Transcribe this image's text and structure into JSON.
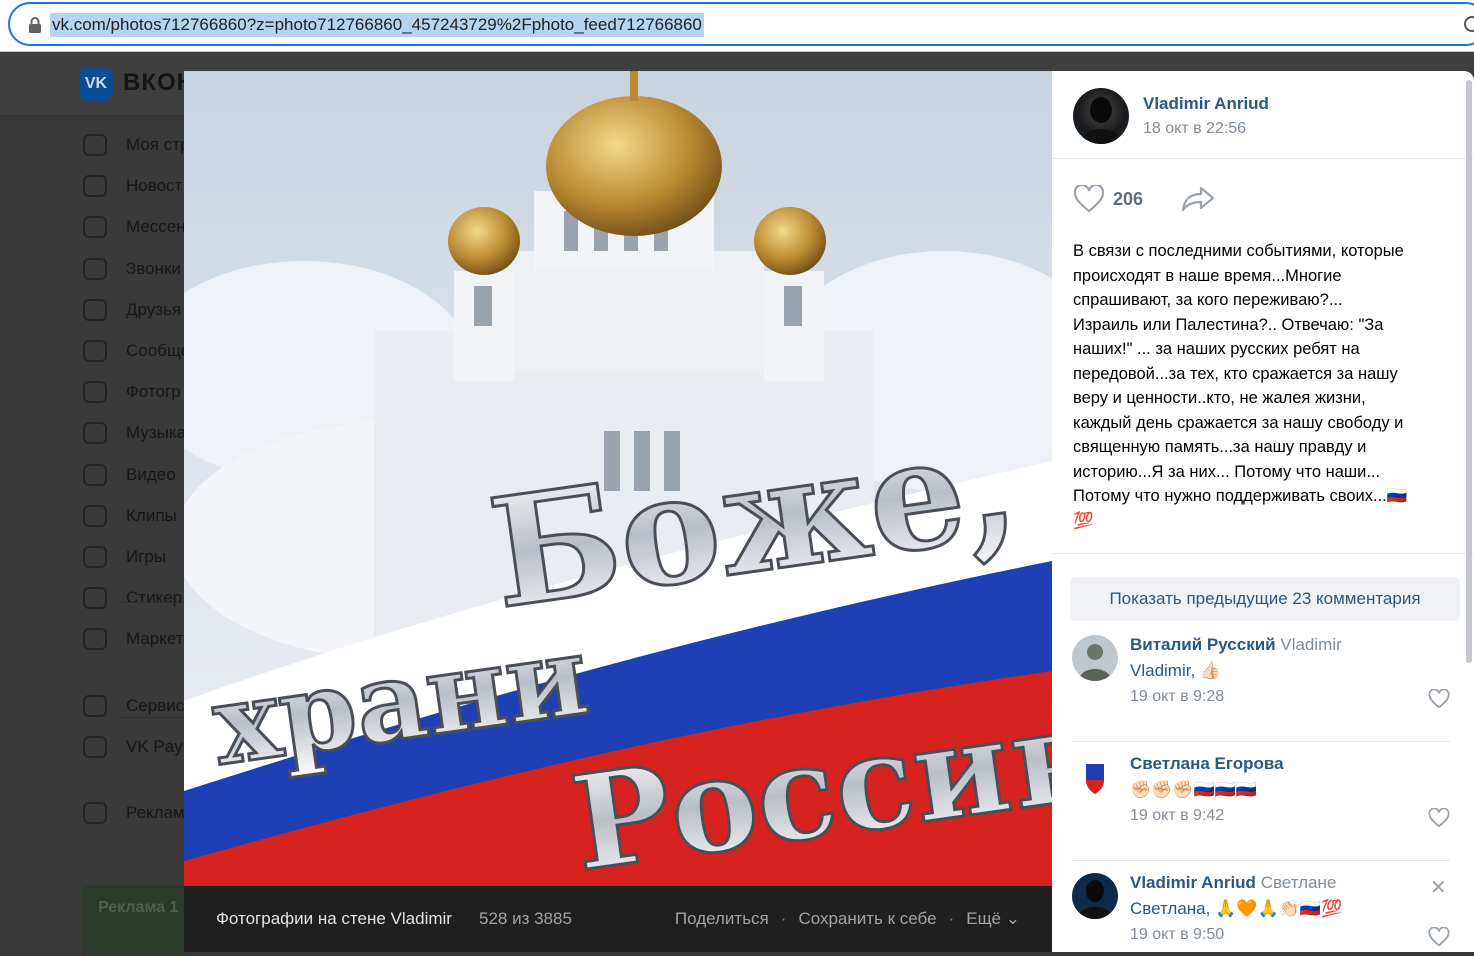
{
  "browser": {
    "url": "vk.com/photos712766860?z=photo712766860_457243729%2Fphoto_feed712766860"
  },
  "vk": {
    "brand": "ВКОН",
    "logo": "VK",
    "menu": [
      {
        "label": "Моя стр",
        "icon": "user-circle-icon"
      },
      {
        "label": "Новост",
        "icon": "news-icon"
      },
      {
        "label": "Мессен",
        "icon": "message-icon"
      },
      {
        "label": "Звонки",
        "icon": "phone-icon"
      },
      {
        "label": "Друзья",
        "icon": "friends-icon"
      },
      {
        "label": "Сообще",
        "icon": "communities-icon"
      },
      {
        "label": "Фотогр",
        "icon": "photo-icon"
      },
      {
        "label": "Музыка",
        "icon": "music-icon"
      },
      {
        "label": "Видео",
        "icon": "video-icon"
      },
      {
        "label": "Клипы",
        "icon": "clips-icon"
      },
      {
        "label": "Игры",
        "icon": "gamepad-icon"
      },
      {
        "label": "Стикер",
        "icon": "sticker-icon"
      },
      {
        "label": "Маркет",
        "icon": "market-icon"
      },
      {
        "label": "Сервис",
        "icon": "services-icon"
      },
      {
        "label": "VK Pay",
        "icon": "vkpay-icon"
      },
      {
        "label": "Реклам",
        "icon": "megaphone-icon"
      }
    ],
    "ad_label": "Реклама 1"
  },
  "photo": {
    "caption_line1": "Боже,",
    "caption_line2": "храни",
    "caption_line3": "Россию",
    "album": "Фотографии на стене Vladimir",
    "counter": "528 из 3885",
    "share": "Поделиться",
    "save": "Сохранить к себе",
    "more": "Ещё",
    "dot": "·"
  },
  "post": {
    "author": "Vladimir Anriud",
    "date": "18 окт в 22:56",
    "likes": "206",
    "text": "В связи с последними событиями, которые\nпроисходят в наше время...Многие\nспрашивают, за кого переживаю?...\nИзраиль или Палестина?.. Отвечаю: \"За\nнаших!\" ... за наших русских ребят на\nпередовой...за тех, кто сражается за нашу\nверу и ценности..кто, не жалея жизни,\nкаждый день сражается за нашу свободу и\nсвященную память...за нашу правду и\nисторию...Я за них... Потому что наши...\nПотому что нужно поддерживать своих...🇷🇺\n💯"
  },
  "comments": {
    "show_previous": "Показать предыдущие 23 комментария",
    "items": [
      {
        "author": "Виталий Русский",
        "reply_to": "Vladimir",
        "mention": "Vladimir,",
        "text": "👍🏻",
        "date": "19 окт в 9:28"
      },
      {
        "author": "Светлана Егорова",
        "reply_to": "",
        "mention": "",
        "text": "✊🏻✊🏻✊🏻🇷🇺🇷🇺🇷🇺",
        "date": "19 окт в 9:42"
      },
      {
        "author": "Vladimir Anriud",
        "reply_to": "Светлане",
        "mention": "Светлана,",
        "text": "🙏🧡🙏👏🏻🇷🇺💯",
        "date": "19 окт в 9:50"
      }
    ]
  },
  "colors": {
    "link": "#2a5885",
    "muted": "#818c99",
    "accent": "#1a73e8"
  }
}
